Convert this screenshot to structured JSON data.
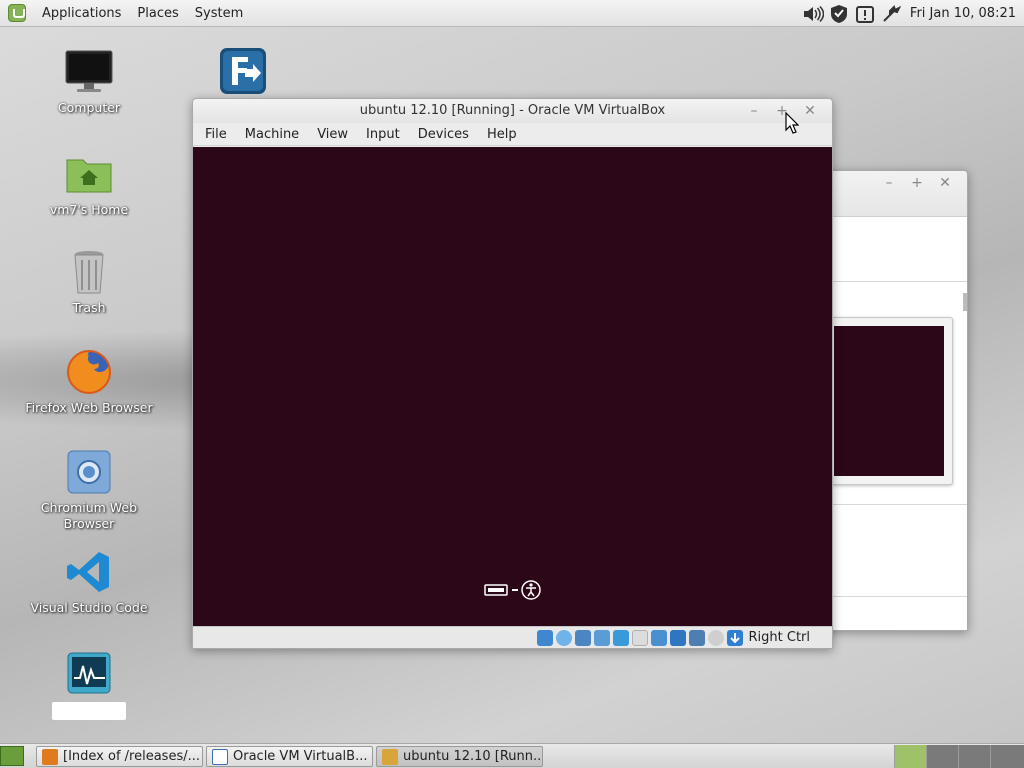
{
  "top_panel": {
    "menu": [
      "Applications",
      "Places",
      "System"
    ],
    "clock": "Fri Jan 10, 08:21",
    "tray_icons": [
      "volume-icon",
      "shield-icon",
      "update-icon",
      "network-icon"
    ]
  },
  "desktop": {
    "icons": [
      {
        "name": "desktop-icon-computer",
        "icon": "monitor-icon",
        "label": "Computer"
      },
      {
        "name": "desktop-icon-home",
        "icon": "home-folder-icon",
        "label": "vm7's Home"
      },
      {
        "name": "desktop-icon-trash",
        "icon": "trash-icon",
        "label": "Trash"
      },
      {
        "name": "desktop-icon-firefox",
        "icon": "firefox-icon",
        "label": "Firefox Web Browser"
      },
      {
        "name": "desktop-icon-chromium",
        "icon": "chromium-icon",
        "label": "Chromium Web Browser"
      },
      {
        "name": "desktop-icon-vscode",
        "icon": "vscode-icon",
        "label": "Visual Studio Code"
      },
      {
        "name": "desktop-icon-monitor",
        "icon": "system-monitor-icon",
        "label": ""
      }
    ],
    "extra_icon": "filezilla-icon"
  },
  "vbox_window": {
    "title": "ubuntu 12.10 [Running] - Oracle VM VirtualBox",
    "menu": [
      "File",
      "Machine",
      "View",
      "Input",
      "Devices",
      "Help"
    ],
    "host_key": "Right Ctrl",
    "screen_color": "#2c0718"
  },
  "bg_window": {
    "title": ""
  },
  "taskbar": {
    "tasks": [
      {
        "label": "[Index of /releases/...",
        "icon": "firefox-icon"
      },
      {
        "label": "Oracle VM VirtualB...",
        "icon": "virtualbox-icon"
      },
      {
        "label": "ubuntu 12.10 [Runn...",
        "icon": "virtualbox-vm-icon"
      }
    ]
  }
}
